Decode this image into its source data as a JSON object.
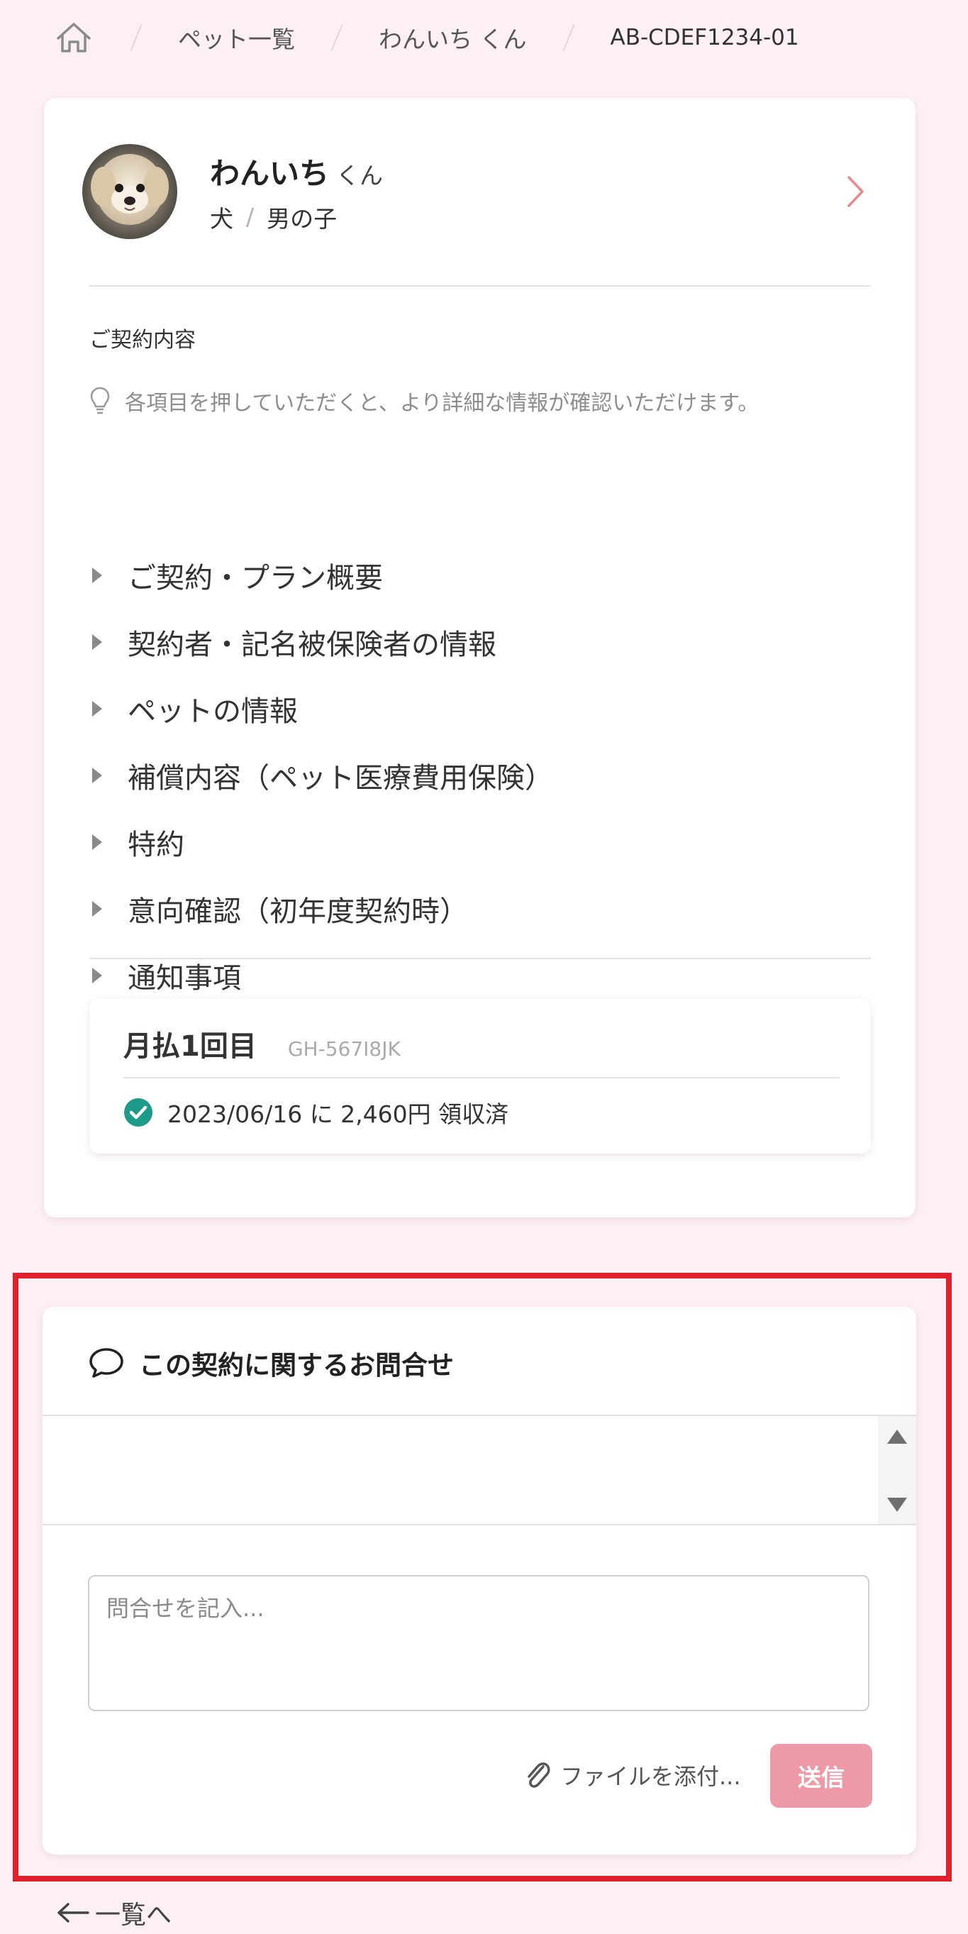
{
  "breadcrumb": {
    "home_icon": "home-icon",
    "pets": "ペット一覧",
    "pet": "わんいち くん",
    "contract_id": "AB-CDEF1234-01"
  },
  "pet": {
    "name": "わんいち",
    "honorific": "くん",
    "species": "犬",
    "sex": "男の子",
    "avatar": "dog-avatar"
  },
  "contract": {
    "section_title": "ご契約内容",
    "hint": "各項目を押していただくと、より詳細な情報が確認いただけます。",
    "items": [
      {
        "label": "ご契約・プラン概要"
      },
      {
        "label": "契約者・記名被保険者の情報"
      },
      {
        "label": "ペットの情報"
      },
      {
        "label": "補償内容（ペット医療費用保険）"
      },
      {
        "label": "特約"
      },
      {
        "label": "意向確認（初年度契約時）"
      },
      {
        "label": "通知事項"
      }
    ]
  },
  "payment": {
    "title": "月払1回目",
    "code": "GH-567I8JK",
    "status": "2023/06/16 に 2,460円 領収済",
    "status_color": "#1e9a8a"
  },
  "inquiry": {
    "title": "この契約に関するお問合せ",
    "placeholder": "問合せを記入...",
    "attach_label": "ファイルを添付...",
    "send_label": "送信",
    "send_color": "#ee9aa6"
  },
  "back": {
    "label": "一覧へ"
  },
  "colors": {
    "background": "#fdf0f5",
    "highlight": "#e0202c",
    "chevron": "#e8898f"
  }
}
